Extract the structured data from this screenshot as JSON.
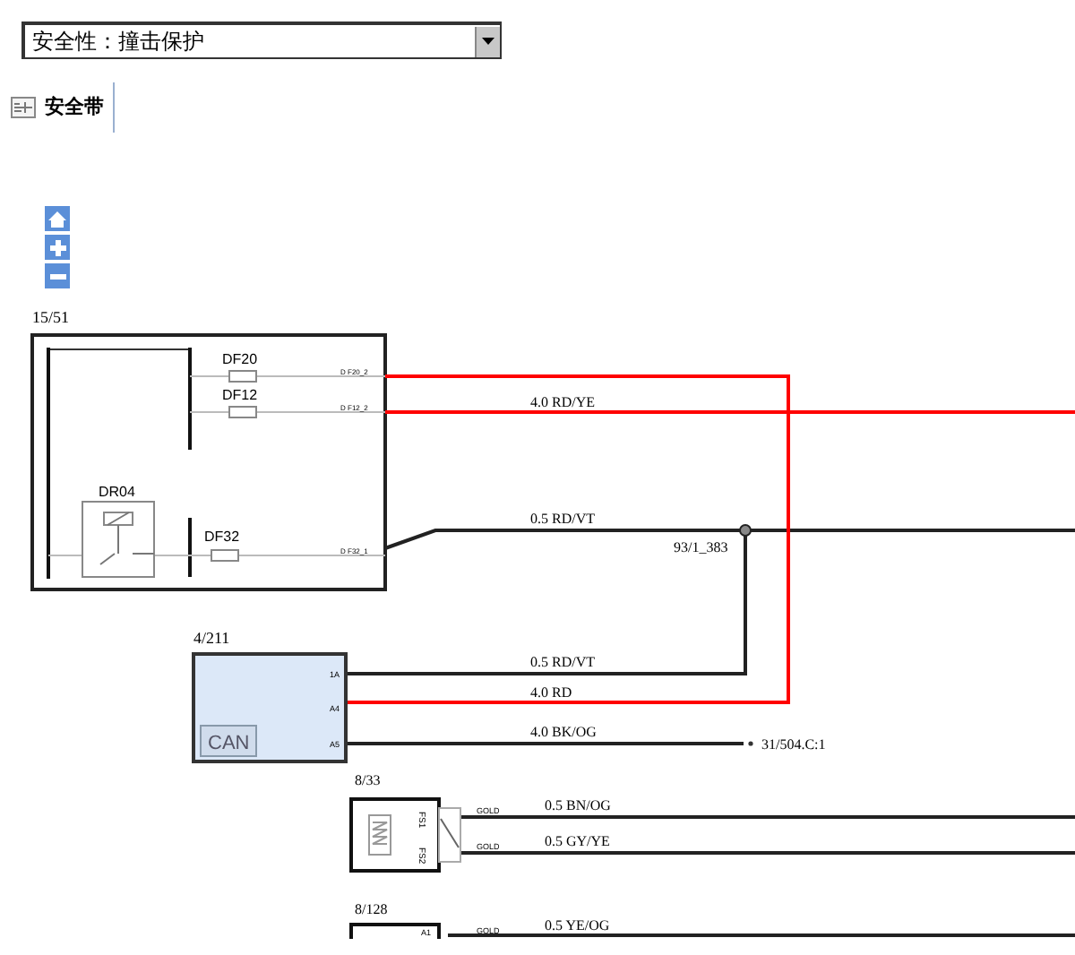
{
  "dropdown": {
    "value": "安全性：撞击保护"
  },
  "tab": {
    "label": "安全带",
    "selected": true
  },
  "diagram": {
    "module_1": {
      "ref": "15/51",
      "relay": "DR04",
      "fuses": [
        {
          "label": "DF20",
          "pin": "D F20_2"
        },
        {
          "label": "DF12",
          "pin": "D F12_2"
        },
        {
          "label": "DF32",
          "pin": "D F32_1"
        }
      ]
    },
    "module_2": {
      "ref": "4/211",
      "badge": "CAN",
      "pins": [
        "1A",
        "A4",
        "A5"
      ]
    },
    "module_3": {
      "ref": "8/33",
      "pins": [
        "FS1",
        "FS2"
      ],
      "terminals": [
        "GOLD",
        "GOLD"
      ]
    },
    "module_4": {
      "ref": "8/128",
      "pins": [
        "A1"
      ],
      "terminals": [
        "GOLD"
      ]
    },
    "splice": {
      "label": "93/1_383"
    },
    "ground": {
      "label": "31/504.C:1"
    },
    "wires": [
      {
        "label": "4.0 RD/YE",
        "color": "#ff0000"
      },
      {
        "label": "0.5 RD/VT",
        "color": "#222222"
      },
      {
        "label": "0.5 RD/VT",
        "color": "#222222"
      },
      {
        "label": "4.0 RD",
        "color": "#ff0000"
      },
      {
        "label": "4.0 BK/OG",
        "color": "#222222"
      },
      {
        "label": "0.5 BN/OG",
        "color": "#222222"
      },
      {
        "label": "0.5 GY/YE",
        "color": "#222222"
      },
      {
        "label": "0.5 YE/OG",
        "color": "#222222"
      }
    ]
  }
}
